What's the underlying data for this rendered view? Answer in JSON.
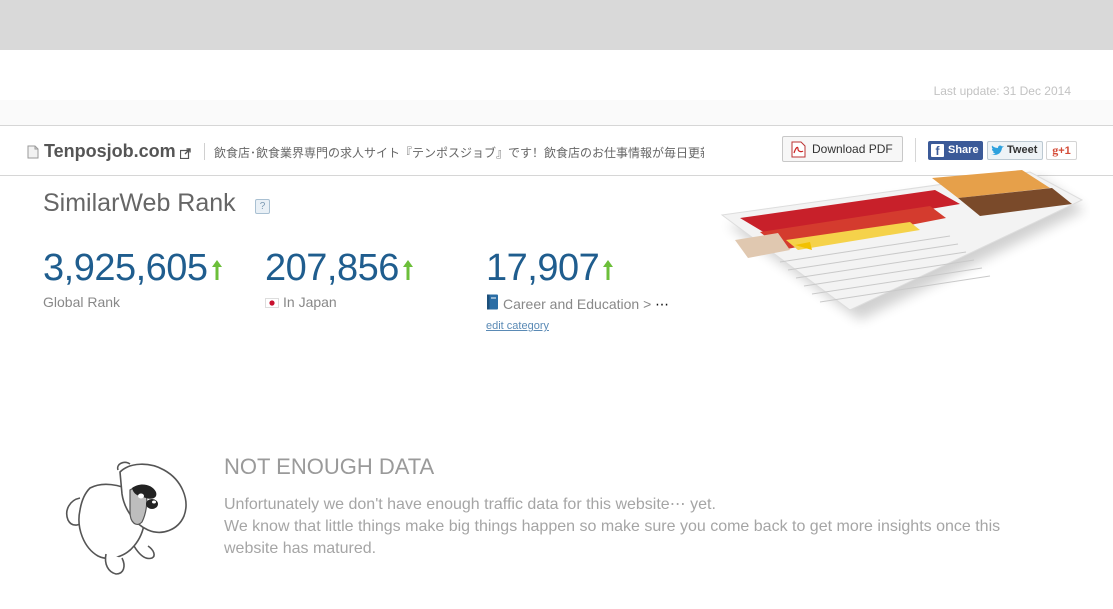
{
  "header": {
    "last_update": "Last update: 31 Dec 2014"
  },
  "site": {
    "name": "Tenposjob.com",
    "description": "飲食店･飲食業界専門の求人サイト『テンポスジョブ』です！飲食店のお仕事情報が毎日更新さ…",
    "icon": "page-icon",
    "external_icon": "external-link-icon"
  },
  "actions": {
    "download_pdf": "Download PDF",
    "facebook": "Share",
    "twitter": "Tweet",
    "gplus": "+1",
    "colors": {
      "facebook": "#3b5a98",
      "gplus": "#d44b37",
      "twitter_bird": "#2ea1dd"
    }
  },
  "rank": {
    "title": "SimilarWeb Rank",
    "help": "?",
    "global": {
      "value": "3,925,605",
      "label": "Global Rank",
      "trend": "up"
    },
    "country": {
      "value": "207,856",
      "label": "In Japan",
      "trend": "up"
    },
    "category": {
      "value": "17,907",
      "label": "Career and Education >",
      "more": "⋯",
      "trend": "up",
      "edit": "edit category"
    },
    "colors": {
      "value": "#1f5d8e",
      "arrow": "#6cbf3a"
    }
  },
  "no_data": {
    "title": "NOT ENOUGH DATA",
    "line1": "Unfortunately we don't have enough traffic data for this website⋯  yet.",
    "line2": "We know that little things make big things happen so make sure you come back to get more insights once this website has matured."
  }
}
